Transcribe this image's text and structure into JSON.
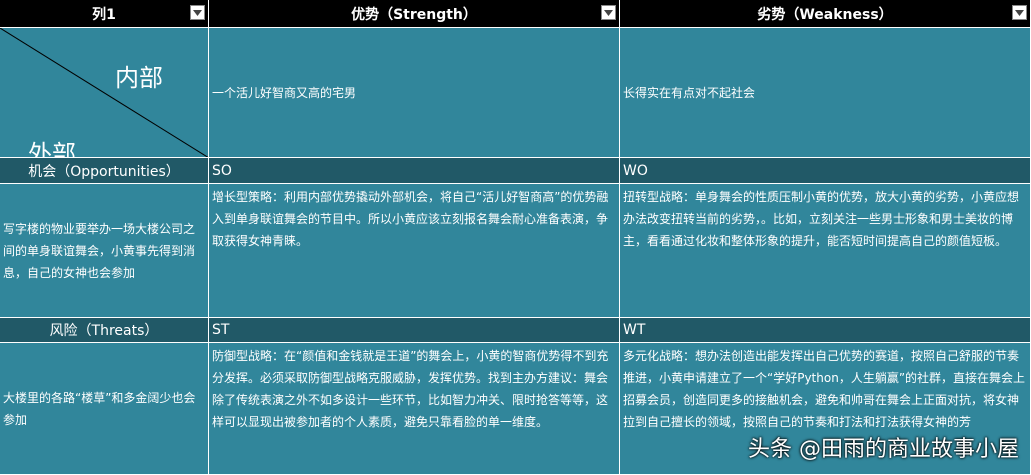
{
  "header": {
    "col1": "列1",
    "col2": "优势（Strength）",
    "col3": "劣势（Weakness）"
  },
  "corner": {
    "inner": "内部",
    "outer": "外部"
  },
  "internal_row": {
    "strength": "一个活儿好智商又高的宅男",
    "weakness": "长得实在有点对不起社会"
  },
  "opportunities": {
    "label": "机会（Opportunities）",
    "so_code": "SO",
    "wo_code": "WO",
    "desc": "写字楼的物业要举办一场大楼公司之间的单身联谊舞会，小黄事先得到消息，自己的女神也会参加",
    "so_text": "增长型策略：利用内部优势撬动外部机会，将自己“活儿好智商高”的优势融入到单身联谊舞会的节目中。所以小黄应该立刻报名舞会耐心准备表演，争取获得女神青睐。",
    "wo_text": "扭转型战略：单身舞会的性质压制小黄的优势，放大小黄的劣势，小黄应想办法改变扭转当前的劣势，。比如，立刻关注一些男士形象和男士美妆的博主，看看通过化妆和整体形象的提升，能否短时间提高自己的颜值短板。"
  },
  "threats": {
    "label": "风险（Threats）",
    "st_code": "ST",
    "wt_code": "WT",
    "desc": "大楼里的各路“楼草”和多金阔少也会参加",
    "st_text": "防御型战略：在“颜值和金钱就是王道”的舞会上，小黄的智商优势得不到充分发挥。必须采取防御型战略克服威胁，发挥优势。找到主办方建议：舞会除了传统表演之外不如多设计一些环节，比如智力冲关、限时抢答等等，这样可以显现出被参加者的个人素质，避免只靠看脸的单一维度。",
    "wt_text": "多元化战略：想办法创造出能发挥出自己优势的赛道，按照自己舒服的节奏推进，小黄申请建立了一个“学好Python，人生躺赢”的社群，直接在舞会上招募会员，创造同更多的接触机会，避免和帅哥在舞会上正面对抗，将女神拉到自己擅长的领域，按照自己的节奏和打法和打法获得女神的芳"
  },
  "watermark": "头条 @田雨的商业故事小屋",
  "colors": {
    "dark": "#215967",
    "light": "#31869b",
    "header": "#000000"
  }
}
